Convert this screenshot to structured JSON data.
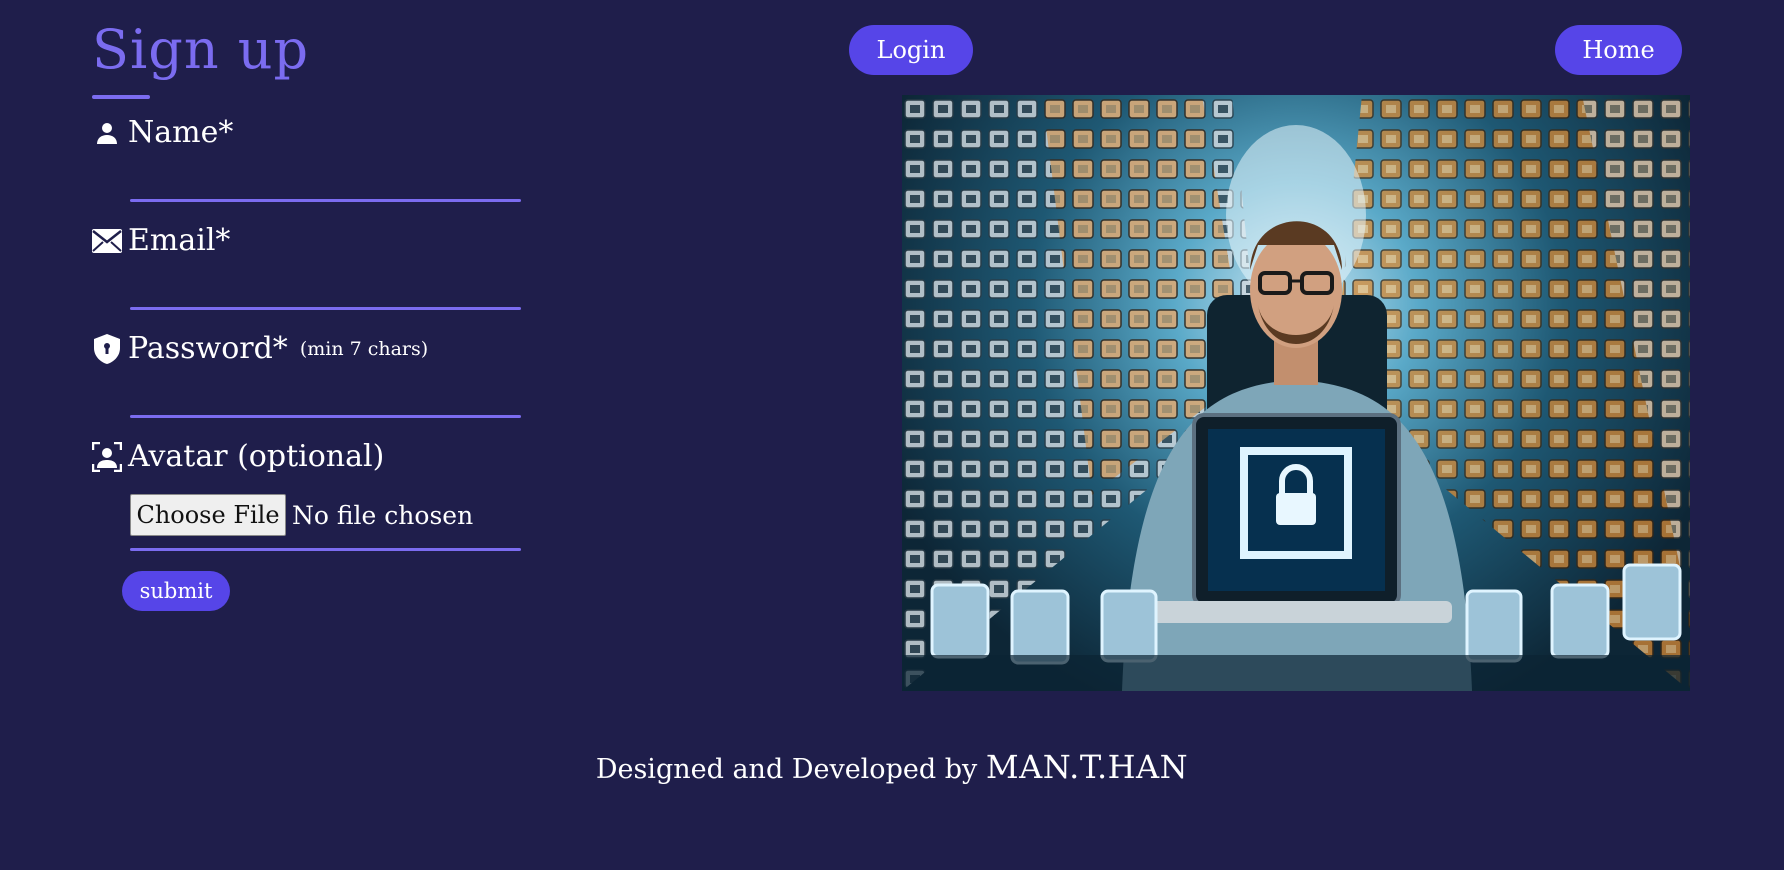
{
  "page": {
    "title": "Sign up"
  },
  "nav": {
    "login_label": "Login",
    "home_label": "Home"
  },
  "form": {
    "name": {
      "label": "Name*",
      "icon": "user-icon",
      "value": ""
    },
    "email": {
      "label": "Email*",
      "icon": "envelope-icon",
      "value": ""
    },
    "password": {
      "label": "Password*",
      "note": "(min 7 chars)",
      "icon": "shield-icon",
      "value": ""
    },
    "avatar": {
      "label": "Avatar (optional)",
      "icon": "avatar-frame-icon",
      "choose_label": "Choose File",
      "status": "No file chosen"
    },
    "submit_label": "submit"
  },
  "footer": {
    "prefix": "Designed and Developed by",
    "author": "MAN.T.HAN"
  },
  "colors": {
    "background": "#1f1e4b",
    "accent": "#5645e8",
    "underline": "#7b6cf0"
  }
}
